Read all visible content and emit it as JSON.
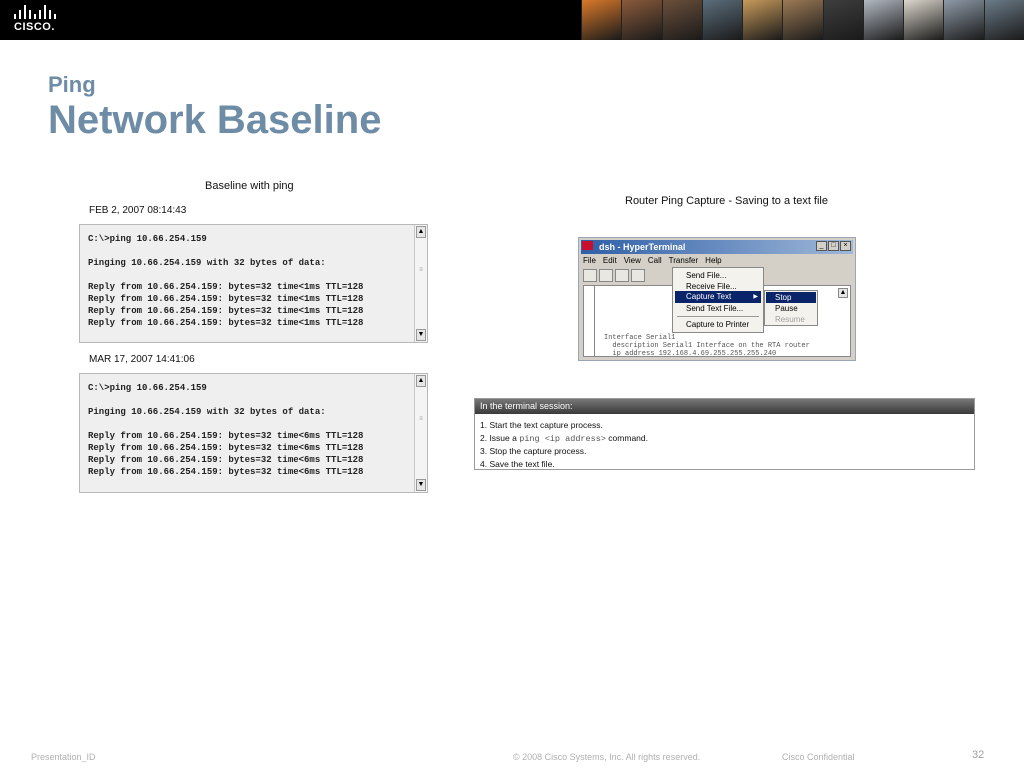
{
  "header": {
    "logo_text": "CISCO.",
    "photo_colors": [
      "#d9792a",
      "#8a5a3a",
      "#6b4f3a",
      "#5b6e7c",
      "#c79a5a",
      "#9c7a55",
      "#3e3e3e",
      "#b2b9c2",
      "#dcd7cd",
      "#8e9aa8",
      "#6b7b88"
    ]
  },
  "slide": {
    "subtitle": "Ping",
    "title": "Network Baseline"
  },
  "left": {
    "caption": "Baseline with ping",
    "capture1_date": "FEB 2, 2007  08:14:43",
    "capture1_text": "C:\\>ping 10.66.254.159\n\nPinging 10.66.254.159 with 32 bytes of data:\n\nReply from 10.66.254.159: bytes=32 time<1ms TTL=128\nReply from 10.66.254.159: bytes=32 time<1ms TTL=128\nReply from 10.66.254.159: bytes=32 time<1ms TTL=128\nReply from 10.66.254.159: bytes=32 time<1ms TTL=128",
    "capture2_date": "MAR 17, 2007  14:41:06",
    "capture2_text": "C:\\>ping 10.66.254.159\n\nPinging 10.66.254.159 with 32 bytes of data:\n\nReply from 10.66.254.159: bytes=32 time<6ms TTL=128\nReply from 10.66.254.159: bytes=32 time<6ms TTL=128\nReply from 10.66.254.159: bytes=32 time<6ms TTL=128\nReply from 10.66.254.159: bytes=32 time<6ms TTL=128",
    "scroll_up": "▲",
    "scroll_down": "▼",
    "scroll_thumb": "≡"
  },
  "hyperterminal": {
    "caption": "Router Ping Capture - Saving to a text file",
    "window_title": "dsh - HyperTerminal",
    "window_buttons": [
      "_",
      "□",
      "×"
    ],
    "menu": [
      "File",
      "Edit",
      "View",
      "Call",
      "Transfer",
      "Help"
    ],
    "transfer_menu": [
      "Send File...",
      "Receive File...",
      "Capture Text",
      "Send Text File...",
      "Capture to Printer"
    ],
    "capture_submenu": [
      "Stop",
      "Pause",
      "Resume"
    ],
    "submenu_arrow": "▶",
    "scroll_up": "▲",
    "terminal_text": "Interface Serial1\n  description Serial1 Interface on the RTA router\n  ip address 192.168.4.69.255.255.255.240"
  },
  "session": {
    "header": "In the terminal session:",
    "step1": "1. Start the text capture process.",
    "step2_pre": "2. Issue a ",
    "step2_code": "ping <ip address>",
    "step2_post": " command.",
    "step3": "3. Stop the capture process.",
    "step4": "4. Save the text file."
  },
  "footer": {
    "presentation_id": "Presentation_ID",
    "copyright": "© 2008 Cisco Systems, Inc. All rights reserved.",
    "confidential": "Cisco Confidential",
    "page_number": "32"
  }
}
